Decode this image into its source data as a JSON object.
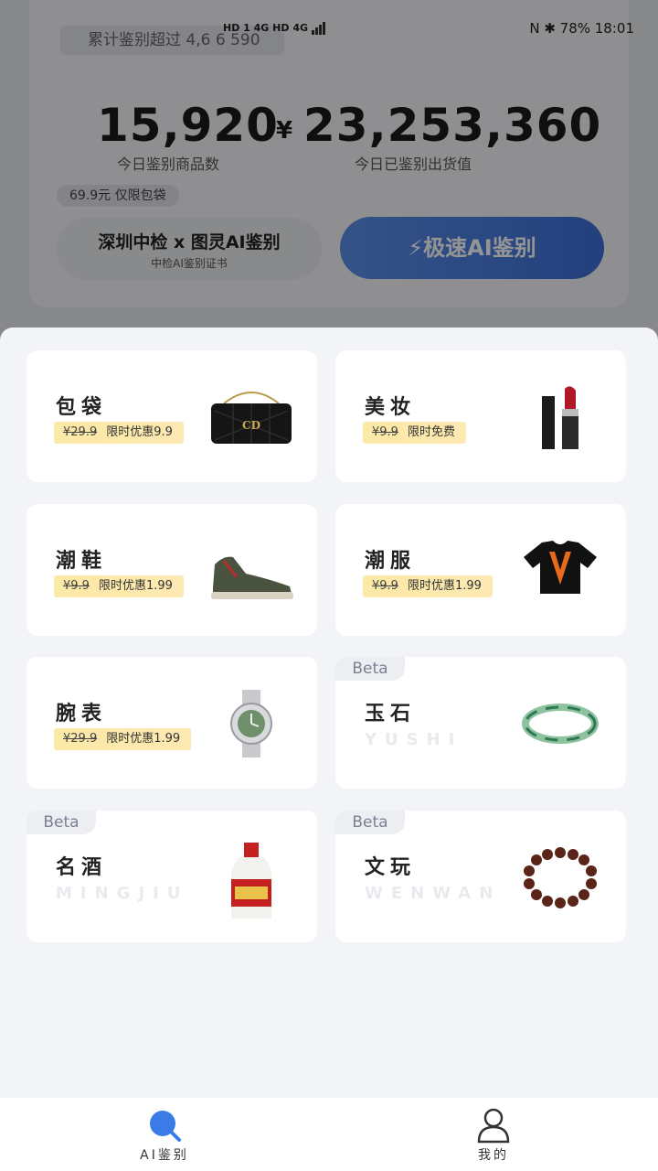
{
  "status_bar": {
    "left": "HD 1 4G HD 4G",
    "right": "N  ✱  78%  18:01",
    "time": "18:01",
    "battery": "78%"
  },
  "header": {
    "total_count": "累计鉴别超过 4,6 6 590",
    "today_goods_count": "15,920",
    "today_goods_label": "今日鉴别商品数",
    "today_value_currency": "¥",
    "today_value": "23,253,360",
    "today_value_label": "今日已鉴别出货值",
    "price_tag": "69.9元 仅限包袋",
    "cert_title": "深圳中检 x 图灵AI鉴别",
    "cert_subtitle": "中检AI鉴别证书",
    "ai_button": "极速AI鉴别"
  },
  "categories": [
    {
      "name": "包袋",
      "old_price": "¥29.9",
      "promo": "限时优惠9.9",
      "icon": "handbag-icon"
    },
    {
      "name": "美妆",
      "old_price": "¥9.9",
      "promo": "限时免费",
      "icon": "lipstick-icon"
    },
    {
      "name": "潮鞋",
      "old_price": "¥9.9",
      "promo": "限时优惠1.99",
      "icon": "sneaker-icon"
    },
    {
      "name": "潮服",
      "old_price": "¥9.9",
      "promo": "限时优惠1.99",
      "icon": "tshirt-icon"
    },
    {
      "name": "腕表",
      "old_price": "¥29.9",
      "promo": "限时优惠1.99",
      "icon": "watch-icon"
    },
    {
      "name": "玉石",
      "beta": "Beta",
      "pinyin": "YUSHI",
      "icon": "jade-bangle-icon"
    },
    {
      "name": "名酒",
      "beta": "Beta",
      "pinyin": "MINGJIU",
      "icon": "liquor-bottle-icon"
    },
    {
      "name": "文玩",
      "beta": "Beta",
      "pinyin": "WENWAN",
      "icon": "bead-bracelet-icon"
    }
  ],
  "tabbar": {
    "tab_ai": "AI鉴别",
    "tab_mine": "我的",
    "active_color": "#3b7be8"
  },
  "colors": {
    "accent_blue": "#3d6fd9",
    "promo_yellow": "#fbe9a6"
  }
}
